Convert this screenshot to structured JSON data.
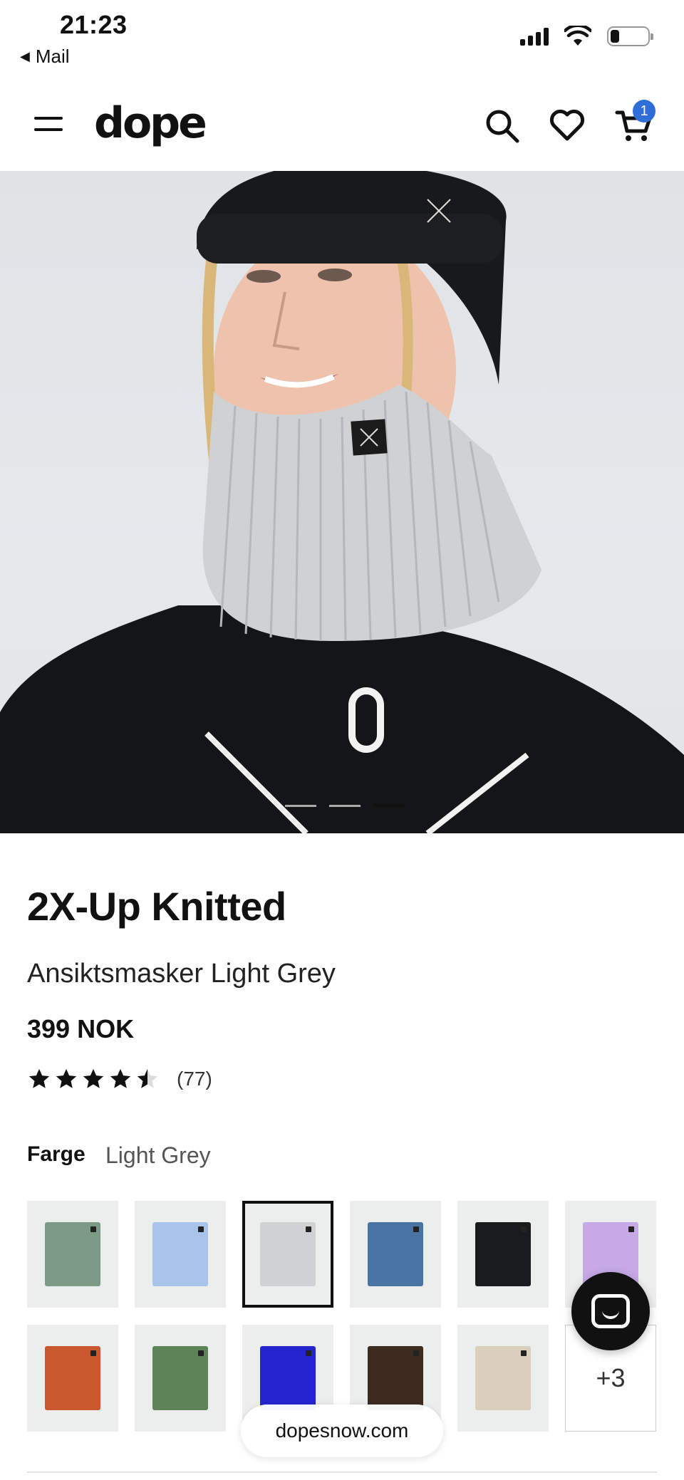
{
  "status_bar": {
    "time": "21:23",
    "back_label": "Mail"
  },
  "header": {
    "logo": "dope",
    "cart_count": "1"
  },
  "carousel": {
    "slide_count": 3,
    "active_index": 3
  },
  "product": {
    "title": "2X-Up Knitted",
    "subtitle": "Ansiktsmasker Light Grey",
    "price": "399 NOK",
    "rating_value": 4.5,
    "rating_count": "(77)"
  },
  "color_picker": {
    "label": "Farge",
    "selected": "Light Grey",
    "swatches": [
      {
        "color": "#7c9a86"
      },
      {
        "color": "#a9c4ea"
      },
      {
        "color": "#d0d1d2",
        "selected": true
      },
      {
        "color": "#4a74a4"
      },
      {
        "color": "#1a1b1d"
      },
      {
        "color": "#c6a9e6"
      },
      {
        "color": "#c9582d"
      },
      {
        "color": "#5f8358"
      },
      {
        "color": "#2525cf"
      },
      {
        "color": "#3d2b20"
      },
      {
        "color": "#d9cfbc"
      }
    ],
    "more_label": "+3"
  },
  "browser": {
    "url": "dopesnow.com"
  },
  "colors": {
    "badge": "#2f6ed8",
    "text": "#111111"
  }
}
